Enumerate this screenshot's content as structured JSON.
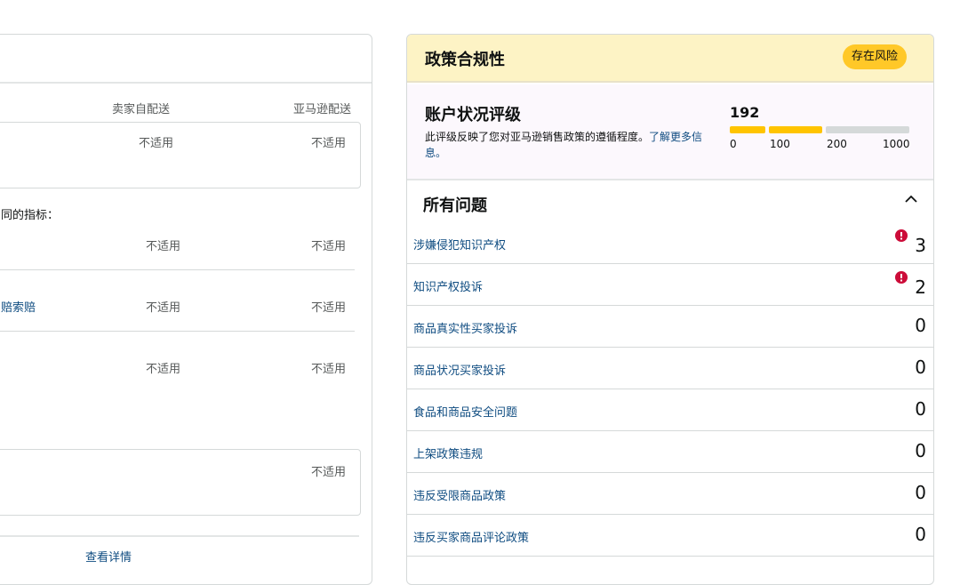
{
  "left": {
    "col_self_ship": "卖家自配送",
    "col_fba": "亚马逊配送",
    "na": "不适用",
    "partial_metric_text": "同的指标：",
    "partial_link_text": "赔索赔",
    "view_details": "查看详情"
  },
  "policy": {
    "title": "政策合规性",
    "badge": "存在风险",
    "health": {
      "title": "账户状况评级",
      "desc_text": "此评级反映了您对亚马逊销售政策的遵循程度。",
      "desc_link": "了解更多信息。",
      "score": "192",
      "ticks": [
        "0",
        "100",
        "200",
        "1000"
      ],
      "bar_colors": [
        "#ffc400",
        "#ffc400",
        "#d5d9d9"
      ]
    },
    "issues_title": "所有问题",
    "issues": [
      {
        "label": "涉嫌侵犯知识产权",
        "count": "3",
        "alert": true
      },
      {
        "label": "知识产权投诉",
        "count": "2",
        "alert": true
      },
      {
        "label": "商品真实性买家投诉",
        "count": "0",
        "alert": false
      },
      {
        "label": "商品状况买家投诉",
        "count": "0",
        "alert": false
      },
      {
        "label": "食品和商品安全问题",
        "count": "0",
        "alert": false
      },
      {
        "label": "上架政策违规",
        "count": "0",
        "alert": false
      },
      {
        "label": "违反受限商品政策",
        "count": "0",
        "alert": false
      },
      {
        "label": "违反买家商品评论政策",
        "count": "0",
        "alert": false
      }
    ],
    "colors": {
      "alert": "#cc0c39",
      "link": "#0f4c81",
      "header_bg": "#fdf3c5",
      "badge": "#ffc828"
    }
  }
}
